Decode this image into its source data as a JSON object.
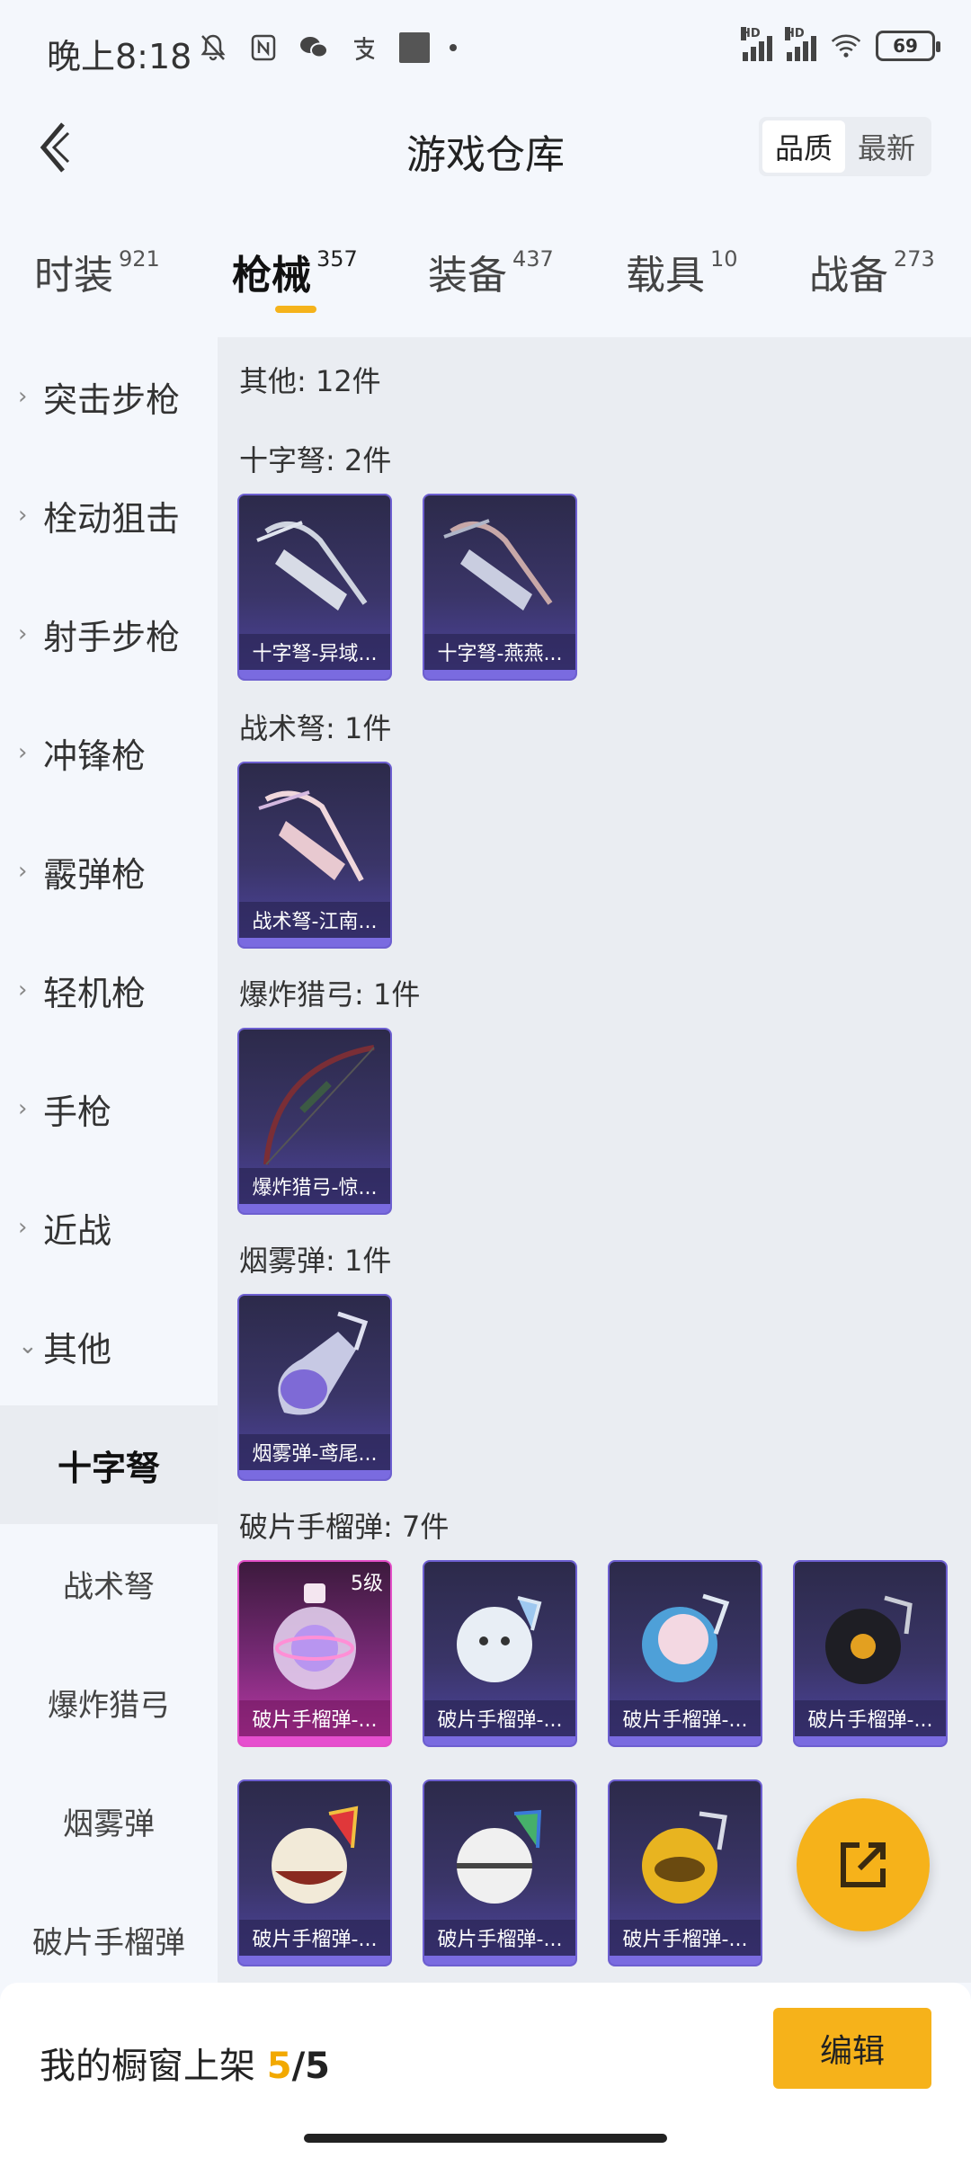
{
  "status_bar": {
    "time": "晚上8:18",
    "battery": "69",
    "signal_label_1": "HD",
    "signal_label_2": "HD"
  },
  "header": {
    "title": "游戏仓库",
    "sort_options": [
      "品质",
      "最新"
    ],
    "active_sort": "品质"
  },
  "tabs": [
    {
      "label": "时装",
      "count": "921"
    },
    {
      "label": "枪械",
      "count": "357"
    },
    {
      "label": "装备",
      "count": "437"
    },
    {
      "label": "载具",
      "count": "10"
    },
    {
      "label": "战备",
      "count": "273"
    }
  ],
  "sidebar": {
    "categories": [
      "突击步枪",
      "栓动狙击",
      "射手步枪",
      "冲锋枪",
      "霰弹枪",
      "轻机枪",
      "手枪",
      "近战",
      "其他"
    ],
    "subcategories": [
      "十字弩",
      "战术弩",
      "爆炸猎弓",
      "烟雾弹",
      "破片手榴弹"
    ],
    "active_subcategory": "十字弩"
  },
  "content": {
    "summary": "其他: 12件",
    "sections": [
      {
        "title": "十字弩: 2件",
        "items": [
          {
            "name": "十字弩-异域..."
          },
          {
            "name": "十字弩-燕燕..."
          }
        ]
      },
      {
        "title": "战术弩: 1件",
        "items": [
          {
            "name": "战术弩-江南..."
          }
        ]
      },
      {
        "title": "爆炸猎弓: 1件",
        "items": [
          {
            "name": "爆炸猎弓-惊..."
          }
        ]
      },
      {
        "title": "烟雾弹: 1件",
        "items": [
          {
            "name": "烟雾弹-鸢尾..."
          }
        ]
      },
      {
        "title": "破片手榴弹: 7件",
        "items": [
          {
            "name": "破片手榴弹-...",
            "level": "5级"
          },
          {
            "name": "破片手榴弹-..."
          },
          {
            "name": "破片手榴弹-..."
          },
          {
            "name": "破片手榴弹-..."
          },
          {
            "name": "破片手榴弹-..."
          },
          {
            "name": "破片手榴弹-..."
          },
          {
            "name": "破片手榴弹-..."
          }
        ]
      }
    ]
  },
  "bottom_bar": {
    "showcase_label": "我的橱窗上架",
    "showcase_count": "5",
    "showcase_total": "/5",
    "edit_label": "编辑"
  },
  "colors": {
    "accent": "#f6b21a",
    "card_purple": "#4e44a0",
    "card_pink": "#c03aa8"
  }
}
